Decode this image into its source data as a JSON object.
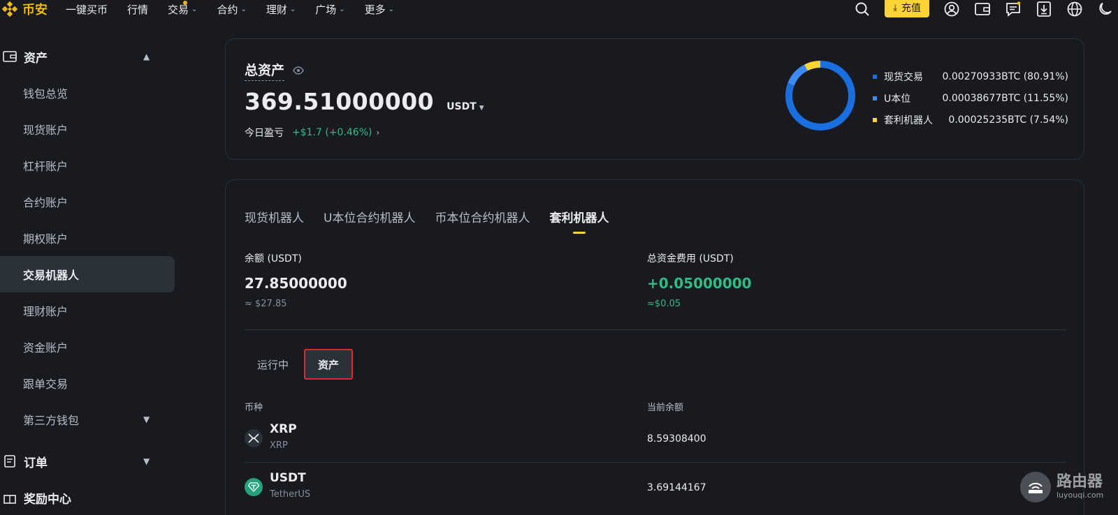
{
  "brand": {
    "logo_text": "币安",
    "color": "#f0b90b"
  },
  "nav": {
    "items": [
      {
        "label": "一键买币",
        "dropdown": false
      },
      {
        "label": "行情",
        "dropdown": false
      },
      {
        "label": "交易",
        "dropdown": true
      },
      {
        "label": "合约",
        "dropdown": true
      },
      {
        "label": "理财",
        "dropdown": true
      },
      {
        "label": "广场",
        "dropdown": true
      },
      {
        "label": "更多",
        "dropdown": true
      }
    ],
    "deposit_label": "充值",
    "right_icons": [
      "search-icon",
      "user-icon",
      "wallet-icon",
      "message-icon",
      "download-icon",
      "globe-icon",
      "moon-icon"
    ]
  },
  "sidebar": {
    "assets_group": "资产",
    "items": [
      {
        "label": "钱包总览"
      },
      {
        "label": "现货账户"
      },
      {
        "label": "杠杆账户"
      },
      {
        "label": "合约账户"
      },
      {
        "label": "期权账户"
      },
      {
        "label": "交易机器人",
        "active": true
      },
      {
        "label": "理财账户"
      },
      {
        "label": "资金账户"
      },
      {
        "label": "跟单交易"
      },
      {
        "label": "第三方钱包",
        "expandable": true
      }
    ],
    "orders_group": "订单",
    "rewards_group": "奖励中心"
  },
  "total": {
    "title": "总资产",
    "amount": "369.51000000",
    "unit": "USDT",
    "pnl_label": "今日盈亏",
    "pnl_value": "+$1.7 (+0.46%)"
  },
  "chart_data": {
    "type": "pie",
    "categories": [
      "现货交易",
      "U本位",
      "套利机器人"
    ],
    "values": [
      80.91,
      11.55,
      7.54
    ],
    "value_labels": [
      "0.00270933BTC (80.91%)",
      "0.00038677BTC (11.55%)",
      "0.00025235BTC (7.54%)"
    ],
    "colors": [
      "#1a6fe0",
      "#3d8cf5",
      "#fcd535"
    ],
    "legend_position": "right"
  },
  "bots": {
    "tabs": [
      "现货机器人",
      "U本位合约机器人",
      "币本位合约机器人",
      "套利机器人"
    ],
    "active_tab": 3,
    "balance_label": "余额 (USDT)",
    "balance_value": "27.85000000",
    "balance_approx": "≈ $27.85",
    "fee_label": "总资金费用 (USDT)",
    "fee_value": "+0.05000000",
    "fee_approx": "≈$0.05",
    "sub_tabs": [
      "运行中",
      "资产"
    ],
    "table_headers": [
      "币种",
      "当前余额"
    ],
    "rows": [
      {
        "symbol": "XRP",
        "name": "XRP",
        "balance": "8.59308400",
        "icon": "xrp-icon"
      },
      {
        "symbol": "USDT",
        "name": "TetherUS",
        "balance": "3.69144167",
        "icon": "tether-icon"
      }
    ]
  },
  "watermark": {
    "title": "路由器",
    "subtitle": "luyouqi.com"
  }
}
